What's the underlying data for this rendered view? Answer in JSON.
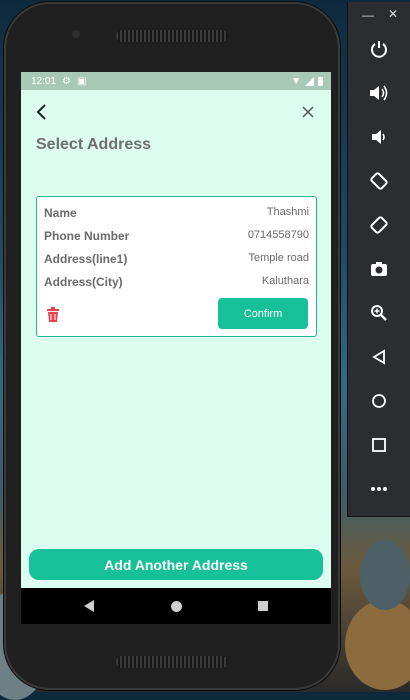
{
  "status_bar": {
    "time": "12:01"
  },
  "page": {
    "title": "Select Address"
  },
  "address_card": {
    "rows": [
      {
        "label": "Name",
        "value": "Thashmi"
      },
      {
        "label": "Phone Number",
        "value": "0714558790"
      },
      {
        "label": "Address(line1)",
        "value": "Temple road"
      },
      {
        "label": "Address(City)",
        "value": "Kaluthara"
      }
    ],
    "confirm_label": "Confirm"
  },
  "footer": {
    "add_label": "Add Another Address"
  },
  "colors": {
    "accent": "#16c199",
    "background": "#dcfdef",
    "border": "#27b590",
    "delete": "#e4464f"
  },
  "emulator_panel": {
    "window_controls": [
      "minimize-icon",
      "close-icon"
    ],
    "tools": [
      "power-icon",
      "volume-up-icon",
      "volume-down-icon",
      "rotate-left-icon",
      "rotate-right-icon",
      "camera-icon",
      "zoom-icon",
      "back-icon",
      "home-icon",
      "overview-icon",
      "more-icon"
    ]
  }
}
